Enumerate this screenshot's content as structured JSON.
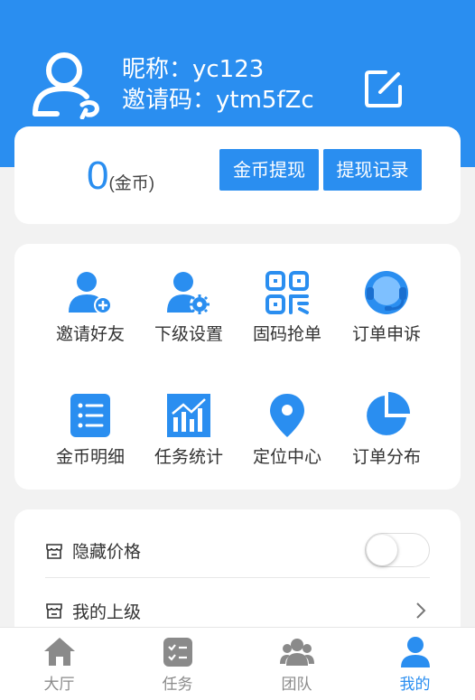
{
  "colors": {
    "primary": "#2a8ef0",
    "background": "#f2f2f2",
    "inactive": "#8a8a8a"
  },
  "profile": {
    "nickname": "昵称：yc123",
    "invite_code": "邀请码：ytm5fZc",
    "avatar_icon": "user-icon",
    "edit_icon": "edit-icon"
  },
  "balance": {
    "amount": "0",
    "unit": "(金币)",
    "withdraw_label": "金币提现",
    "record_label": "提现记录"
  },
  "features": [
    {
      "label": "邀请好友",
      "icon": "user-add-icon"
    },
    {
      "label": "下级设置",
      "icon": "user-gear-icon"
    },
    {
      "label": "固码抢单",
      "icon": "qrcode-icon"
    },
    {
      "label": "订单申诉",
      "icon": "headset-icon"
    },
    {
      "label": "金币明细",
      "icon": "list-icon"
    },
    {
      "label": "任务统计",
      "icon": "bar-chart-icon"
    },
    {
      "label": "定位中心",
      "icon": "location-pin-icon"
    },
    {
      "label": "订单分布",
      "icon": "pie-chart-icon"
    }
  ],
  "settings": {
    "hide_price_label": "隐藏价格",
    "hide_price_on": false,
    "superior_label": "我的上级"
  },
  "tabbar": [
    {
      "label": "大厅",
      "icon": "home-icon",
      "active": false
    },
    {
      "label": "任务",
      "icon": "task-icon",
      "active": false
    },
    {
      "label": "团队",
      "icon": "team-icon",
      "active": false
    },
    {
      "label": "我的",
      "icon": "me-icon",
      "active": true
    }
  ]
}
